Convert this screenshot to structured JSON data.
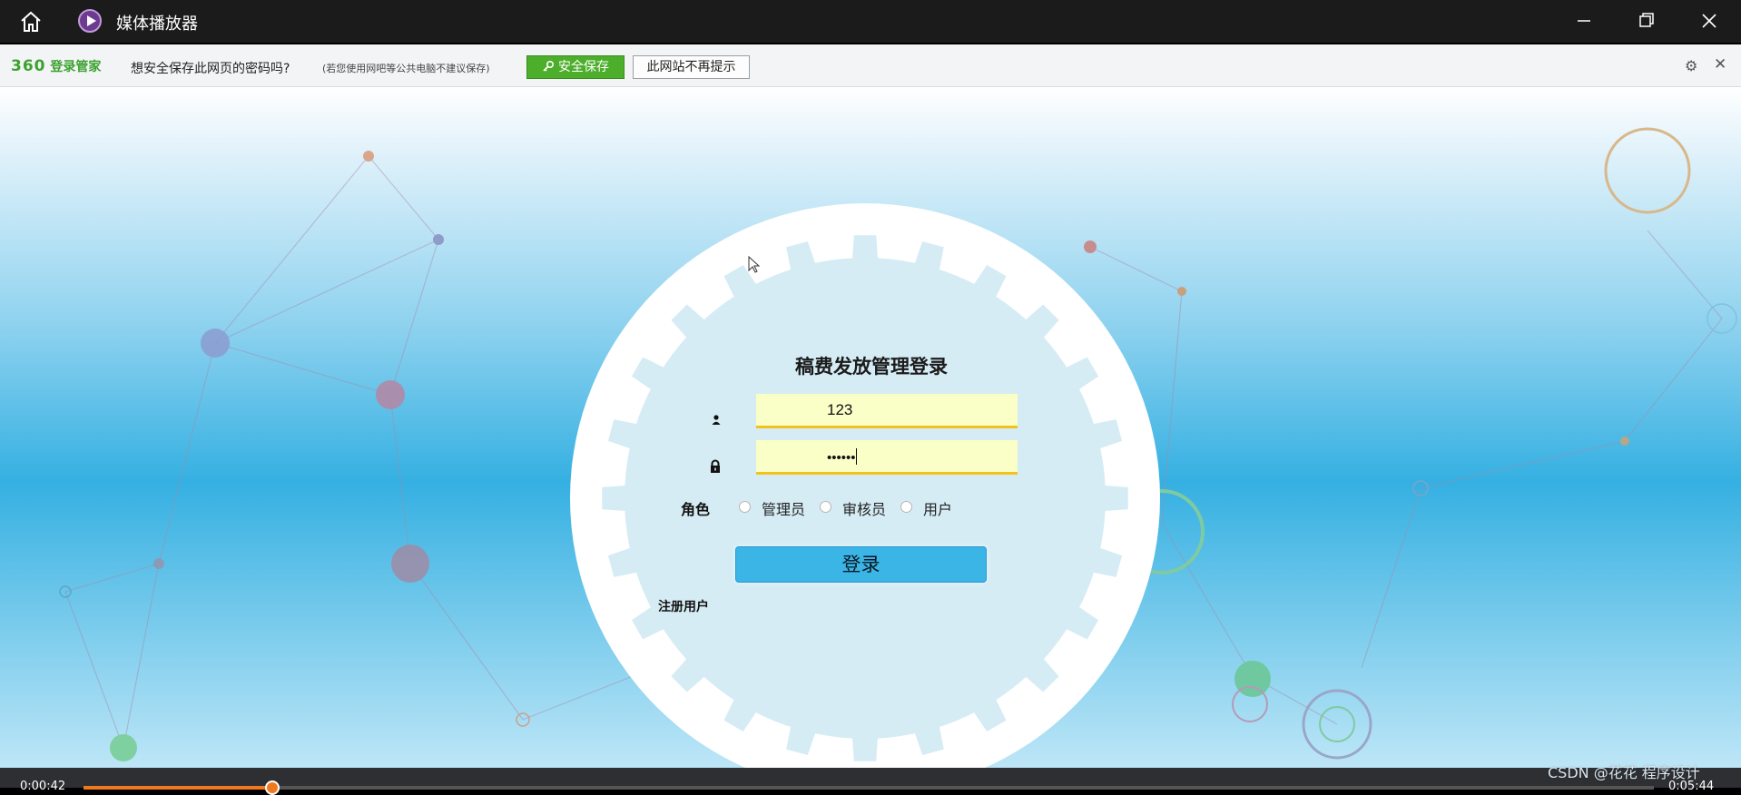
{
  "window": {
    "title": "媒体播放器",
    "icons": {
      "home": "home-icon",
      "app": "play-icon",
      "minimize": "minimize-icon",
      "maximize": "restore-icon",
      "close": "close-icon"
    }
  },
  "password_bar": {
    "brand_num": "360",
    "brand_text": "登录管家",
    "question": "想安全保存此网页的密码吗?",
    "note": "(若您使用网吧等公共电脑不建议保存)",
    "save_label": "安全保存",
    "never_label": "此网站不再提示",
    "gear_icon": "gear-icon",
    "close_icon": "close-icon"
  },
  "login": {
    "title": "稿费发放管理登录",
    "username_value": "123",
    "password_mask": "••••••",
    "role_label": "角色",
    "roles": [
      "管理员",
      "审核员",
      "用户"
    ],
    "login_label": "登录",
    "register_label": "注册用户"
  },
  "player": {
    "time_elapsed": "0:00:42",
    "time_total": "0:05:44",
    "progress": 0.12
  },
  "watermark": "CSDN @花花 程序设计",
  "colors": {
    "accent": "#3bb4e6",
    "save_green": "#4cae2b",
    "field_bg": "#fafec7",
    "field_underline": "#f2c21b",
    "progress": "#f0791f"
  }
}
